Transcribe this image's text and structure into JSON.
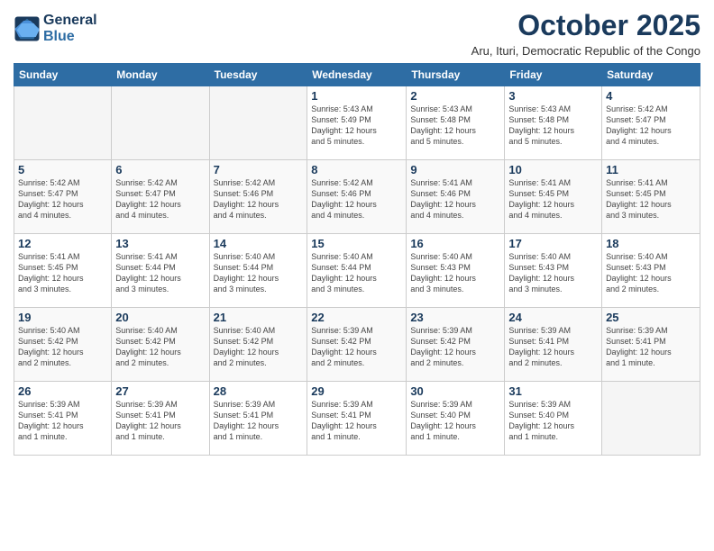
{
  "header": {
    "logo_line1": "General",
    "logo_line2": "Blue",
    "month": "October 2025",
    "location": "Aru, Ituri, Democratic Republic of the Congo"
  },
  "weekdays": [
    "Sunday",
    "Monday",
    "Tuesday",
    "Wednesday",
    "Thursday",
    "Friday",
    "Saturday"
  ],
  "weeks": [
    [
      {
        "day": "",
        "info": ""
      },
      {
        "day": "",
        "info": ""
      },
      {
        "day": "",
        "info": ""
      },
      {
        "day": "1",
        "info": "Sunrise: 5:43 AM\nSunset: 5:49 PM\nDaylight: 12 hours\nand 5 minutes."
      },
      {
        "day": "2",
        "info": "Sunrise: 5:43 AM\nSunset: 5:48 PM\nDaylight: 12 hours\nand 5 minutes."
      },
      {
        "day": "3",
        "info": "Sunrise: 5:43 AM\nSunset: 5:48 PM\nDaylight: 12 hours\nand 5 minutes."
      },
      {
        "day": "4",
        "info": "Sunrise: 5:42 AM\nSunset: 5:47 PM\nDaylight: 12 hours\nand 4 minutes."
      }
    ],
    [
      {
        "day": "5",
        "info": "Sunrise: 5:42 AM\nSunset: 5:47 PM\nDaylight: 12 hours\nand 4 minutes."
      },
      {
        "day": "6",
        "info": "Sunrise: 5:42 AM\nSunset: 5:47 PM\nDaylight: 12 hours\nand 4 minutes."
      },
      {
        "day": "7",
        "info": "Sunrise: 5:42 AM\nSunset: 5:46 PM\nDaylight: 12 hours\nand 4 minutes."
      },
      {
        "day": "8",
        "info": "Sunrise: 5:42 AM\nSunset: 5:46 PM\nDaylight: 12 hours\nand 4 minutes."
      },
      {
        "day": "9",
        "info": "Sunrise: 5:41 AM\nSunset: 5:46 PM\nDaylight: 12 hours\nand 4 minutes."
      },
      {
        "day": "10",
        "info": "Sunrise: 5:41 AM\nSunset: 5:45 PM\nDaylight: 12 hours\nand 4 minutes."
      },
      {
        "day": "11",
        "info": "Sunrise: 5:41 AM\nSunset: 5:45 PM\nDaylight: 12 hours\nand 3 minutes."
      }
    ],
    [
      {
        "day": "12",
        "info": "Sunrise: 5:41 AM\nSunset: 5:45 PM\nDaylight: 12 hours\nand 3 minutes."
      },
      {
        "day": "13",
        "info": "Sunrise: 5:41 AM\nSunset: 5:44 PM\nDaylight: 12 hours\nand 3 minutes."
      },
      {
        "day": "14",
        "info": "Sunrise: 5:40 AM\nSunset: 5:44 PM\nDaylight: 12 hours\nand 3 minutes."
      },
      {
        "day": "15",
        "info": "Sunrise: 5:40 AM\nSunset: 5:44 PM\nDaylight: 12 hours\nand 3 minutes."
      },
      {
        "day": "16",
        "info": "Sunrise: 5:40 AM\nSunset: 5:43 PM\nDaylight: 12 hours\nand 3 minutes."
      },
      {
        "day": "17",
        "info": "Sunrise: 5:40 AM\nSunset: 5:43 PM\nDaylight: 12 hours\nand 3 minutes."
      },
      {
        "day": "18",
        "info": "Sunrise: 5:40 AM\nSunset: 5:43 PM\nDaylight: 12 hours\nand 2 minutes."
      }
    ],
    [
      {
        "day": "19",
        "info": "Sunrise: 5:40 AM\nSunset: 5:42 PM\nDaylight: 12 hours\nand 2 minutes."
      },
      {
        "day": "20",
        "info": "Sunrise: 5:40 AM\nSunset: 5:42 PM\nDaylight: 12 hours\nand 2 minutes."
      },
      {
        "day": "21",
        "info": "Sunrise: 5:40 AM\nSunset: 5:42 PM\nDaylight: 12 hours\nand 2 minutes."
      },
      {
        "day": "22",
        "info": "Sunrise: 5:39 AM\nSunset: 5:42 PM\nDaylight: 12 hours\nand 2 minutes."
      },
      {
        "day": "23",
        "info": "Sunrise: 5:39 AM\nSunset: 5:42 PM\nDaylight: 12 hours\nand 2 minutes."
      },
      {
        "day": "24",
        "info": "Sunrise: 5:39 AM\nSunset: 5:41 PM\nDaylight: 12 hours\nand 2 minutes."
      },
      {
        "day": "25",
        "info": "Sunrise: 5:39 AM\nSunset: 5:41 PM\nDaylight: 12 hours\nand 1 minute."
      }
    ],
    [
      {
        "day": "26",
        "info": "Sunrise: 5:39 AM\nSunset: 5:41 PM\nDaylight: 12 hours\nand 1 minute."
      },
      {
        "day": "27",
        "info": "Sunrise: 5:39 AM\nSunset: 5:41 PM\nDaylight: 12 hours\nand 1 minute."
      },
      {
        "day": "28",
        "info": "Sunrise: 5:39 AM\nSunset: 5:41 PM\nDaylight: 12 hours\nand 1 minute."
      },
      {
        "day": "29",
        "info": "Sunrise: 5:39 AM\nSunset: 5:41 PM\nDaylight: 12 hours\nand 1 minute."
      },
      {
        "day": "30",
        "info": "Sunrise: 5:39 AM\nSunset: 5:40 PM\nDaylight: 12 hours\nand 1 minute."
      },
      {
        "day": "31",
        "info": "Sunrise: 5:39 AM\nSunset: 5:40 PM\nDaylight: 12 hours\nand 1 minute."
      },
      {
        "day": "",
        "info": ""
      }
    ]
  ]
}
